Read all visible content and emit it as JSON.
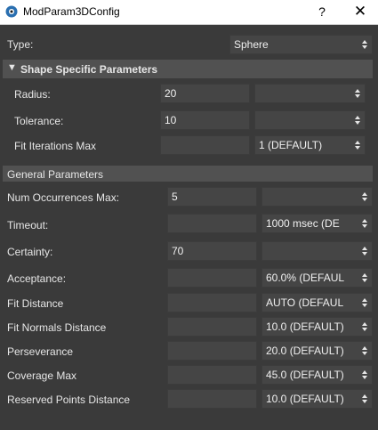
{
  "window": {
    "title": "ModParam3DConfig",
    "help_label": "?",
    "close_label": "✕"
  },
  "type_row": {
    "label": "Type:",
    "value": "Sphere"
  },
  "shape_section": {
    "toggle": "▼",
    "title": "Shape Specific Parameters",
    "rows": [
      {
        "label": "Radius:",
        "value": "20",
        "option": ""
      },
      {
        "label": "Tolerance:",
        "value": "10",
        "option": ""
      },
      {
        "label": "Fit Iterations Max",
        "value": "",
        "option": "1 (DEFAULT)"
      }
    ]
  },
  "general_section": {
    "title": "General Parameters",
    "rows": [
      {
        "label": "Num Occurrences Max:",
        "value": "5",
        "option": ""
      },
      {
        "label": "Timeout:",
        "value": "",
        "option": "1000 msec (DE"
      },
      {
        "label": "Certainty:",
        "value": "70",
        "option": ""
      },
      {
        "label": "Acceptance:",
        "value": "",
        "option": "60.0% (DEFAUL"
      },
      {
        "label": "Fit Distance",
        "value": "",
        "option": "AUTO (DEFAUL"
      },
      {
        "label": "Fit Normals Distance",
        "value": "",
        "option": "10.0 (DEFAULT)"
      },
      {
        "label": "Perseverance",
        "value": "",
        "option": "20.0 (DEFAULT)"
      },
      {
        "label": "Coverage Max",
        "value": "",
        "option": "45.0 (DEFAULT)"
      },
      {
        "label": "Reserved Points Distance",
        "value": "",
        "option": "10.0 (DEFAULT)"
      }
    ]
  }
}
